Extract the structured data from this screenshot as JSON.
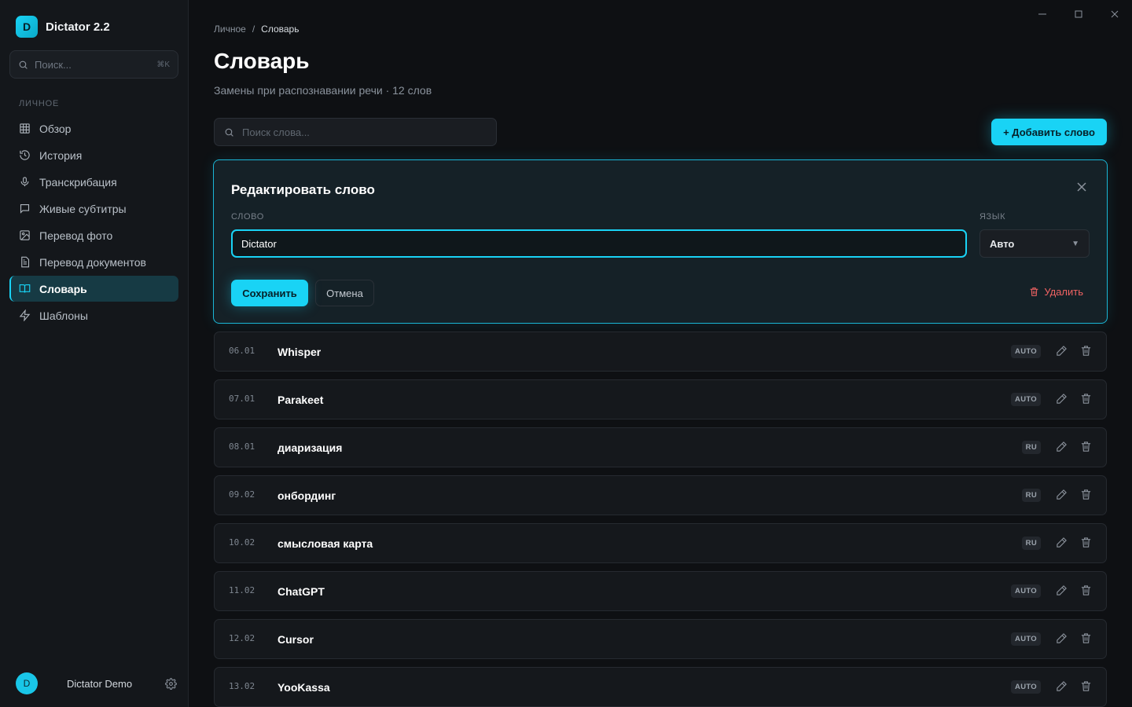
{
  "app": {
    "logo_letter": "D",
    "name": "Dictator 2.2"
  },
  "sidebar": {
    "search_placeholder": "Поиск...",
    "search_shortcut": "⌘K",
    "section_label": "ЛИЧНОЕ",
    "items": [
      {
        "label": "Обзор",
        "icon": "grid-icon"
      },
      {
        "label": "История",
        "icon": "history-icon"
      },
      {
        "label": "Транскрибация",
        "icon": "mic-icon"
      },
      {
        "label": "Живые субтитры",
        "icon": "message-icon"
      },
      {
        "label": "Перевод фото",
        "icon": "image-icon"
      },
      {
        "label": "Перевод документов",
        "icon": "document-icon"
      },
      {
        "label": "Словарь",
        "icon": "book-icon",
        "active": true
      },
      {
        "label": "Шаблоны",
        "icon": "bolt-icon"
      }
    ],
    "user": {
      "initial": "D",
      "name": "Dictator Demo"
    }
  },
  "breadcrumb": {
    "parent": "Личное",
    "separator": "/",
    "current": "Словарь"
  },
  "page": {
    "title": "Словарь",
    "subtitle": "Замены при распознавании речи · 12 слов",
    "search_placeholder": "Поиск слова...",
    "add_button": "+ Добавить слово"
  },
  "edit_panel": {
    "title": "Редактировать слово",
    "word_label": "СЛОВО",
    "word_value": "Dictator",
    "lang_label": "ЯЗЫК",
    "lang_value": "Авто",
    "save_label": "Сохранить",
    "cancel_label": "Отмена",
    "delete_label": "Удалить"
  },
  "words": [
    {
      "date": "06.01",
      "word": "Whisper",
      "lang": "AUTO"
    },
    {
      "date": "07.01",
      "word": "Parakeet",
      "lang": "AUTO"
    },
    {
      "date": "08.01",
      "word": "диаризация",
      "lang": "RU"
    },
    {
      "date": "09.02",
      "word": "онбординг",
      "lang": "RU"
    },
    {
      "date": "10.02",
      "word": "смысловая карта",
      "lang": "RU"
    },
    {
      "date": "11.02",
      "word": "ChatGPT",
      "lang": "AUTO"
    },
    {
      "date": "12.02",
      "word": "Cursor",
      "lang": "AUTO"
    },
    {
      "date": "13.02",
      "word": "YooKassa",
      "lang": "AUTO"
    }
  ],
  "colors": {
    "accent": "#19d3f5",
    "danger": "#f06363",
    "background": "#0e1013",
    "sidebar": "#14171b"
  }
}
